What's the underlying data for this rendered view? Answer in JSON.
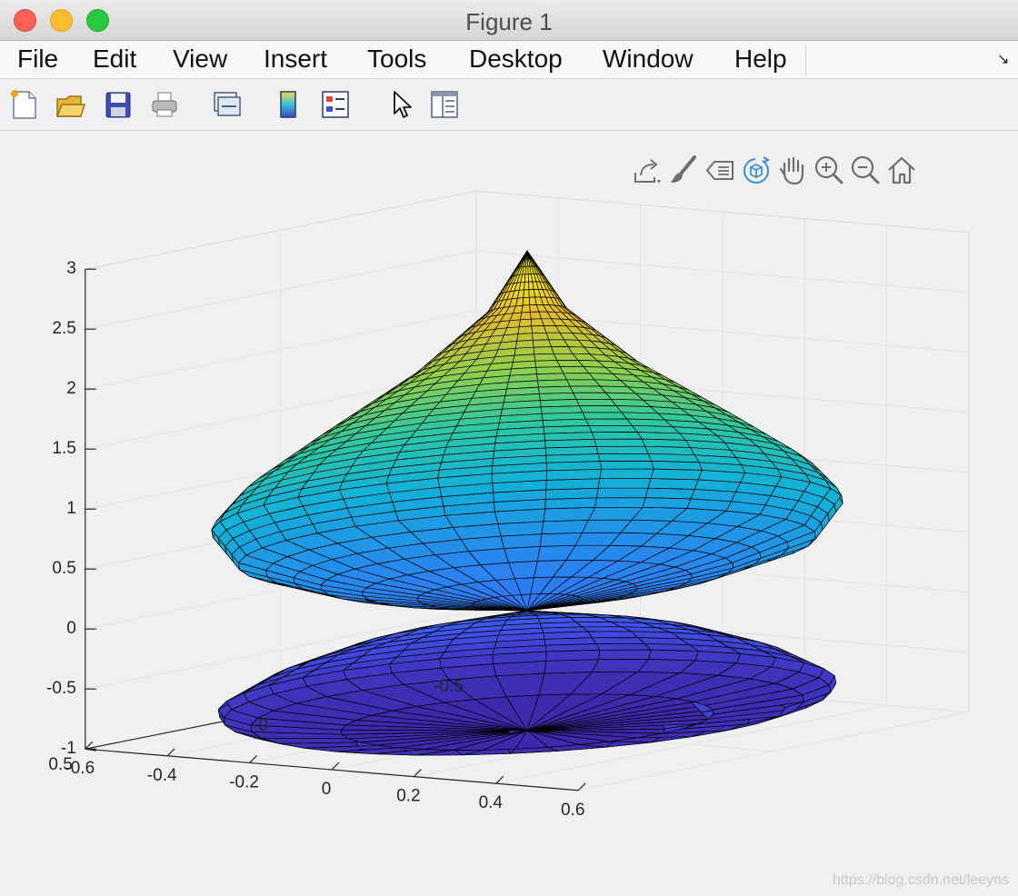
{
  "window": {
    "title": "Figure 1",
    "controls": [
      "close",
      "minimize",
      "zoom"
    ]
  },
  "menubar": {
    "items": [
      {
        "label": "File"
      },
      {
        "label": "Edit"
      },
      {
        "label": "View"
      },
      {
        "label": "Insert"
      },
      {
        "label": "Tools"
      },
      {
        "label": "Desktop"
      },
      {
        "label": "Window"
      },
      {
        "label": "Help"
      }
    ],
    "dock_arrow": "↘"
  },
  "toolbar": {
    "buttons": [
      "new-figure-icon",
      "open-file-icon",
      "save-icon",
      "print-icon",
      "link-plot-icon",
      "colorbar-icon",
      "legend-icon",
      "edit-plot-arrow-icon",
      "property-inspector-icon"
    ]
  },
  "axes_toolbar": {
    "buttons": [
      "export-icon",
      "brush-icon",
      "data-tips-icon",
      "rotate-3d-icon",
      "pan-hand-icon",
      "zoom-in-icon",
      "zoom-out-icon",
      "restore-view-home-icon"
    ],
    "active": "rotate-3d-icon",
    "active_color": "#3a8fd6"
  },
  "chart_data": {
    "type": "surface3d",
    "description_of_surface": "surface of revolution about the z axis; lower lens from z=-1 to 0, upper bulb from z=0 to a cusp at z=3",
    "x_axis": {
      "ticks": [
        "-0.6",
        "-0.4",
        "-0.2",
        "0",
        "0.2",
        "0.4",
        "0.6"
      ],
      "range": [
        -0.6,
        0.6
      ]
    },
    "y_axis": {
      "ticks": [
        "-0.5",
        "0",
        "0.5"
      ],
      "range": [
        -0.5,
        0.5
      ]
    },
    "z_axis": {
      "ticks": [
        "-1",
        "-0.5",
        "0",
        "0.5",
        "1",
        "1.5",
        "2",
        "2.5",
        "3"
      ],
      "range": [
        -1,
        3
      ]
    },
    "grid": true,
    "colormap": "parula",
    "colormap_stops": [
      "#3e26a8",
      "#4250e8",
      "#2c80f2",
      "#12b0d8",
      "#2fc8a0",
      "#8fcf4c",
      "#e6bc2c",
      "#f9fb14"
    ],
    "edge_color": "#000000",
    "profile": [
      {
        "z": -1.0,
        "r": 0.0
      },
      {
        "z": -0.9,
        "r": 0.46
      },
      {
        "z": -0.75,
        "r": 0.56
      },
      {
        "z": -0.5,
        "r": 0.46
      },
      {
        "z": -0.25,
        "r": 0.3
      },
      {
        "z": 0.0,
        "r": 0.0
      },
      {
        "z": 0.25,
        "r": 0.34
      },
      {
        "z": 0.5,
        "r": 0.51
      },
      {
        "z": 0.8,
        "r": 0.56
      },
      {
        "z": 1.1,
        "r": 0.5
      },
      {
        "z": 1.5,
        "r": 0.37
      },
      {
        "z": 2.0,
        "r": 0.2
      },
      {
        "z": 2.5,
        "r": 0.07
      },
      {
        "z": 3.0,
        "r": 0.0
      }
    ]
  },
  "watermark": "https://blog.csdn.net/leeyns"
}
